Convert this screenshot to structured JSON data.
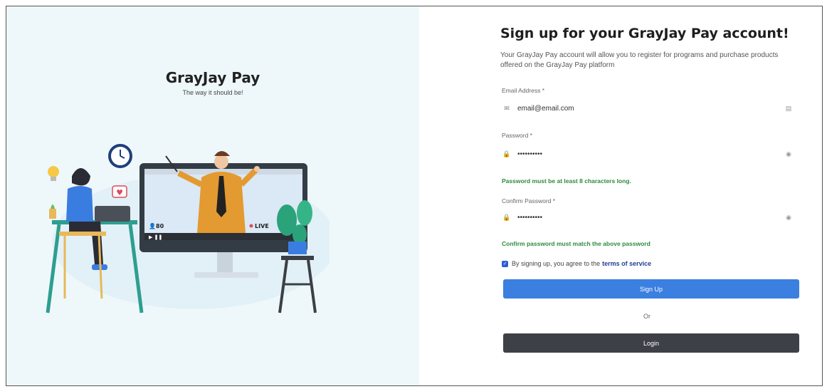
{
  "brand": {
    "name": "GrayJay Pay",
    "tagline": "The way it should be!"
  },
  "illustration": {
    "viewer_count": "80",
    "live_badge": "LIVE"
  },
  "form": {
    "title": "Sign up for your GrayJay Pay account!",
    "subtitle": "Your GrayJay Pay account will allow you to register for programs and purchase products offered on the GrayJay Pay platform",
    "email": {
      "label": "Email Address *",
      "value": "email@email.com",
      "icon": "email-icon"
    },
    "password": {
      "label": "Password *",
      "value": "••••••••••",
      "hint": "Password must be at least 8 characters long.",
      "icon": "lock-icon"
    },
    "confirm_password": {
      "label": "Confirm Password *",
      "value": "••••••••••",
      "hint": "Confirm password must match the above password",
      "icon": "lock-icon"
    },
    "agree": {
      "text": "By signing up, you agree to the",
      "link": "terms of service",
      "checked": true
    },
    "signup_label": "Sign Up",
    "or_label": "Or",
    "login_label": "Login"
  },
  "colors": {
    "left_bg": "#eef8fb",
    "primary_button": "#3b7fe0",
    "secondary_button": "#3d4046",
    "hint_green": "#2d8a3e",
    "link_blue": "#1f3f94"
  }
}
